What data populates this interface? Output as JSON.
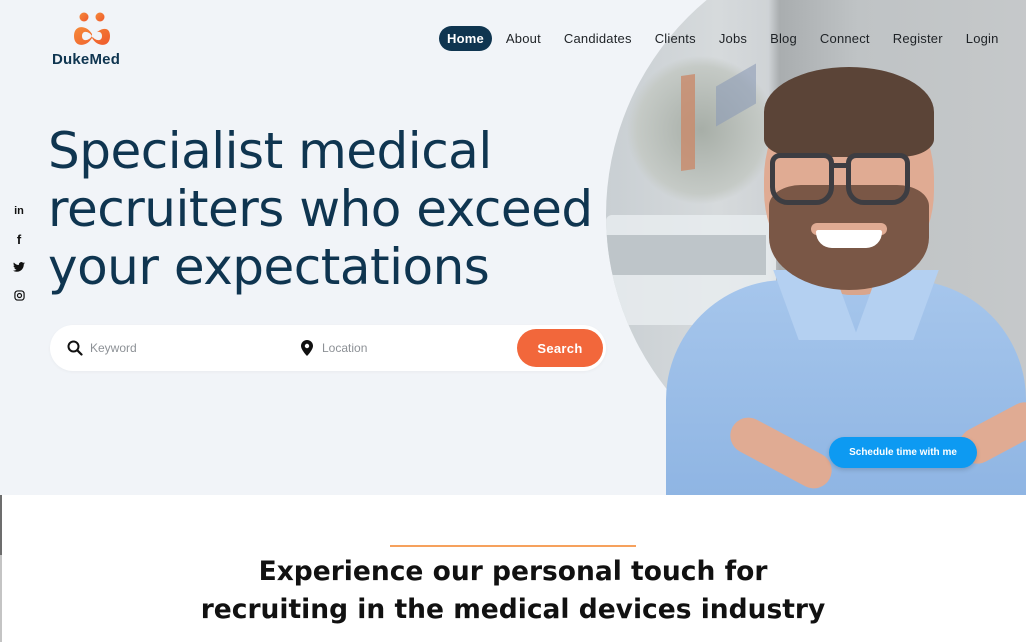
{
  "brand": {
    "name": "DukeMed",
    "logo_icon": "two-people-infinity-logo",
    "colors": {
      "primary": "#0f3550",
      "accent_orange": "#f2673b",
      "accent_blue": "#0d9af2",
      "divider": "#f6a15d",
      "hero_bg": "#f1f4f8"
    }
  },
  "nav": {
    "items": [
      {
        "label": "Home",
        "active": true
      },
      {
        "label": "About",
        "active": false
      },
      {
        "label": "Candidates",
        "active": false
      },
      {
        "label": "Clients",
        "active": false
      },
      {
        "label": "Jobs",
        "active": false
      },
      {
        "label": "Blog",
        "active": false
      },
      {
        "label": "Connect",
        "active": false
      },
      {
        "label": "Register",
        "active": false
      },
      {
        "label": "Login",
        "active": false
      }
    ]
  },
  "social": [
    {
      "name": "linkedin-icon",
      "glyph": "in"
    },
    {
      "name": "facebook-icon",
      "glyph": "f"
    },
    {
      "name": "twitter-icon",
      "glyph": "twitter"
    },
    {
      "name": "instagram-icon",
      "glyph": "instagram"
    }
  ],
  "hero": {
    "headline_lines": [
      "Specialist medical",
      "recruiters who exceed",
      "your expectations"
    ],
    "search": {
      "keyword_placeholder": "Keyword",
      "keyword_value": "",
      "location_placeholder": "Location",
      "location_value": "",
      "button_label": "Search"
    },
    "schedule_button_label": "Schedule time with me",
    "image_alt": "Smiling man with glasses in light blue shirt"
  },
  "intro": {
    "lines": [
      "Experience our personal touch for",
      "recruiting in the medical devices industry"
    ]
  }
}
